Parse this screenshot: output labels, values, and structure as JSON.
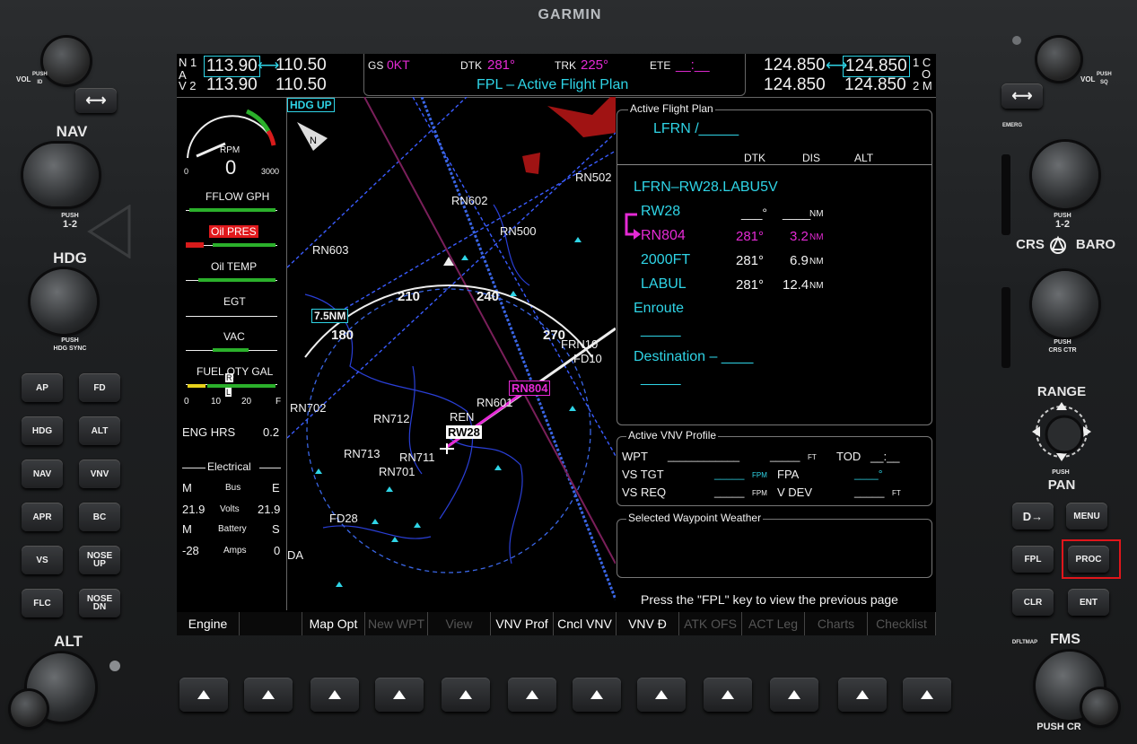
{
  "bezel": {
    "brand": "GARMIN",
    "left": {
      "vol_label": "VOL",
      "vol_push": "PUSH\nID",
      "nav_label": "NAV",
      "nav_push": "PUSH",
      "nav_push2": "1-2",
      "hdg_label": "HDG",
      "hdg_push": "PUSH\nHDG SYNC",
      "alt_label": "ALT",
      "buttons": [
        "AP",
        "FD",
        "HDG",
        "ALT",
        "NAV",
        "VNV",
        "APR",
        "BC",
        "VS",
        "NOSE\nUP",
        "FLC",
        "NOSE\nDN"
      ]
    },
    "right": {
      "vol_label": "VOL",
      "vol_push": "PUSH\nSQ",
      "emerg": "EMERG",
      "com_push": "PUSH",
      "com_push2": "1-2",
      "crs_baro": "CRS",
      "baro": "BARO",
      "crs_push": "PUSH\nCRS CTR",
      "range": "RANGE",
      "pan_push": "PUSH",
      "pan": "PAN",
      "direct": "D→",
      "menu": "MENU",
      "fpl": "FPL",
      "proc": "PROC",
      "clr": "CLR",
      "ent": "ENT",
      "dfltmap": "DFLTMAP",
      "fms": "FMS",
      "fms_push": "PUSH CR"
    }
  },
  "topbar": {
    "nav_label_1": "N 1",
    "nav_label_2": "A",
    "nav_label_3": "V 2",
    "nav1_active": "113.90",
    "nav1_standby": "110.50",
    "nav2_active": "113.90",
    "nav2_standby": "110.50",
    "gs_label": "GS",
    "gs_value": "0KT",
    "dtk_label": "DTK",
    "dtk_value": "281°",
    "trk_label": "TRK",
    "trk_value": "225°",
    "ete_label": "ETE",
    "ete_value": "__:__",
    "page_title": "FPL – Active Flight Plan",
    "com1_active": "124.850",
    "com1_standby": "124.850",
    "com2_active": "124.850",
    "com2_standby": "124.850",
    "com_label_1": "1 C",
    "com_label_2": "O",
    "com_label_3": "2 M"
  },
  "engine": {
    "rpm_label": "RPM",
    "rpm_value": "0",
    "rpm_min": "0",
    "rpm_max": "3000",
    "fflow": "FFLOW GPH",
    "oil_pres": "Oil PRES",
    "oil_temp": "Oil TEMP",
    "egt": "EGT",
    "vac": "VAC",
    "fuel_qty": "FUEL QTY GAL",
    "fuel_ticks": [
      "0",
      "10",
      "20",
      "F"
    ],
    "fuel_r": "R",
    "fuel_l": "L",
    "eng_hrs_label": "ENG HRS",
    "eng_hrs_value": "0.2",
    "electrical": "Electrical",
    "m1": "M",
    "bus": "Bus",
    "e1": "E",
    "volts_l": "21.9",
    "volts": "Volts",
    "volts_r": "21.9",
    "m2": "M",
    "battery": "Battery",
    "s2": "S",
    "amps_l": "-28",
    "amps": "Amps",
    "amps_r": "0"
  },
  "map": {
    "orientation": "HDG UP",
    "north": "N",
    "range": "7.5NM",
    "compass": [
      "180",
      "210",
      "240",
      "270"
    ],
    "waypoints": [
      "RN602",
      "RN502",
      "RN500",
      "RN603",
      "FRN10",
      "FD10",
      "RN804",
      "RN601",
      "RN702",
      "RN712",
      "REN",
      "RW28",
      "RN713",
      "RN711",
      "RN701",
      "FD28",
      "DA"
    ]
  },
  "fpl": {
    "active_title": "Active Flight Plan",
    "route": "LFRN /_____",
    "col_dtk": "DTK",
    "col_dis": "DIS",
    "col_alt": "ALT",
    "procedure": "LFRN–RW28.LABU5V",
    "rows": [
      {
        "name": "RW28",
        "dtk": "___°",
        "dis": "____",
        "unit": "NM"
      },
      {
        "name": "RN804",
        "dtk": "281°",
        "dis": "3.2",
        "unit": "NM"
      },
      {
        "name": "2000FT",
        "dtk": "281°",
        "dis": "6.9",
        "unit": "NM"
      },
      {
        "name": "LABUL",
        "dtk": "281°",
        "dis": "12.4",
        "unit": "NM"
      }
    ],
    "enroute": "Enroute",
    "enroute_blank": "_____",
    "destination": "Destination – ____",
    "dest_blank": "_____",
    "vnv_title": "Active VNV Profile",
    "wpt_label": "WPT",
    "wpt_value": "____________",
    "wpt_alt": "_____",
    "ft": "FT",
    "tod_label": "TOD",
    "tod_value": "__:__",
    "vstgt_label": "VS TGT",
    "vstgt_value": "_____",
    "fpm": "FPM",
    "fpa_label": "FPA",
    "fpa_value": "____°",
    "vsreq_label": "VS REQ",
    "vsreq_value": "_____",
    "fpm2": "FPM",
    "vdev_label": "V DEV",
    "vdev_value": "_____",
    "ft2": "FT",
    "wx_title": "Selected Waypoint Weather",
    "hint": "Press the \"FPL\" key to view the previous page"
  },
  "softkeys": [
    {
      "label": "Engine",
      "dim": false
    },
    {
      "label": "",
      "dim": false
    },
    {
      "label": "Map Opt",
      "dim": false
    },
    {
      "label": "New WPT",
      "dim": true
    },
    {
      "label": "View",
      "dim": true
    },
    {
      "label": "VNV Prof",
      "dim": false
    },
    {
      "label": "Cncl VNV",
      "dim": false
    },
    {
      "label": "VNV Đ",
      "dim": false
    },
    {
      "label": "ATK OFS",
      "dim": true
    },
    {
      "label": "ACT Leg",
      "dim": true
    },
    {
      "label": "Charts",
      "dim": true
    },
    {
      "label": "Checklist",
      "dim": true
    }
  ],
  "colors": {
    "cyan": "#2fd4e6",
    "magenta": "#e52ad5",
    "highlight": "#e0161b"
  }
}
